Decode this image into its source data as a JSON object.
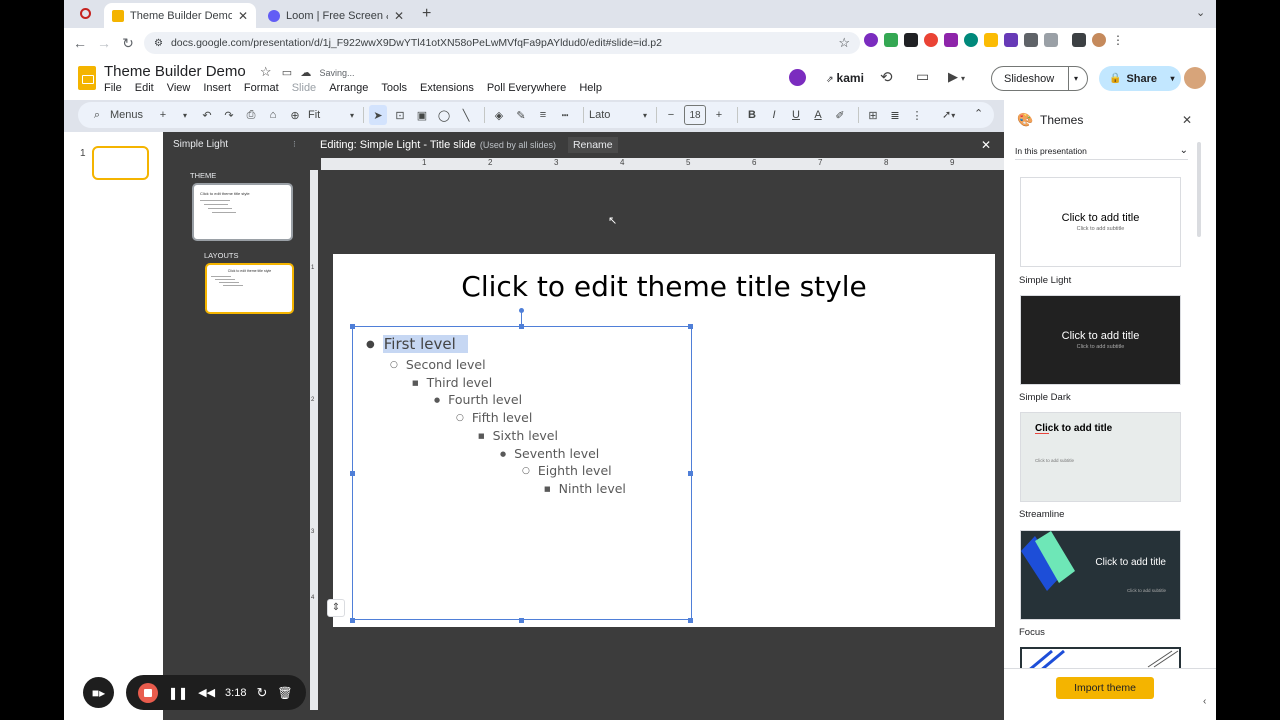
{
  "browser": {
    "tabs": [
      {
        "title": "Theme Builder Demo - Google Slides",
        "active": true
      },
      {
        "title": "Loom | Free Screen & Video Recording",
        "active": false
      }
    ],
    "url": "docs.google.com/presentation/d/1j_F922wwX9DwYTl41otXN58oPeLwMVfqFa9pAYldud0/edit#slide=id.p2"
  },
  "app": {
    "doc_title": "Theme Builder Demo",
    "save_status": "Saving...",
    "menus": [
      "File",
      "Edit",
      "View",
      "Insert",
      "Format",
      "Slide",
      "Arrange",
      "Tools",
      "Extensions",
      "Poll Everywhere",
      "Help"
    ],
    "kami_label": "kami",
    "slideshow_label": "Slideshow",
    "share_label": "Share"
  },
  "toolbar": {
    "search_label": "Menus",
    "zoom_value": "Fit",
    "font_name": "Lato",
    "font_size": "18"
  },
  "filmstrip": {
    "slide_number": "1"
  },
  "theme_builder": {
    "panel_title": "Simple Light",
    "theme_heading": "THEME",
    "layouts_heading": "LAYOUTS",
    "edit_label": "Editing: Simple Light - Title slide",
    "used_by": "(Used by all slides)",
    "rename_label": "Rename",
    "ruler_marks": [
      "1",
      "2",
      "3",
      "4",
      "5",
      "6",
      "7",
      "8",
      "9"
    ],
    "vruler_marks": [
      "1",
      "2",
      "3",
      "4"
    ]
  },
  "slide": {
    "title": "Click to edit theme title style",
    "levels": [
      "First level",
      "Second level",
      "Third level",
      "Fourth level",
      "Fifth level",
      "Sixth level",
      "Seventh level",
      "Eighth level",
      "Ninth level"
    ]
  },
  "themes_panel": {
    "title": "Themes",
    "filter_label": "In this presentation",
    "cards": [
      {
        "name": "Simple Light",
        "title": "Click to add title",
        "subtitle": "Click to add subtitle"
      },
      {
        "name": "Simple Dark",
        "title": "Click to add title",
        "subtitle": "Click to add subtitle"
      },
      {
        "name": "Streamline",
        "title": "Click to add title",
        "subtitle": "Click to add subtitle"
      },
      {
        "name": "Focus",
        "title": "Click to add title",
        "subtitle": "Click to add subtitle"
      }
    ],
    "import_label": "Import theme"
  },
  "loom": {
    "timer": "3:18"
  },
  "colors": {
    "accent_yellow": "#f4b400",
    "selection_blue": "#4f7fd8",
    "dark_panel": "#3c3c3c"
  }
}
